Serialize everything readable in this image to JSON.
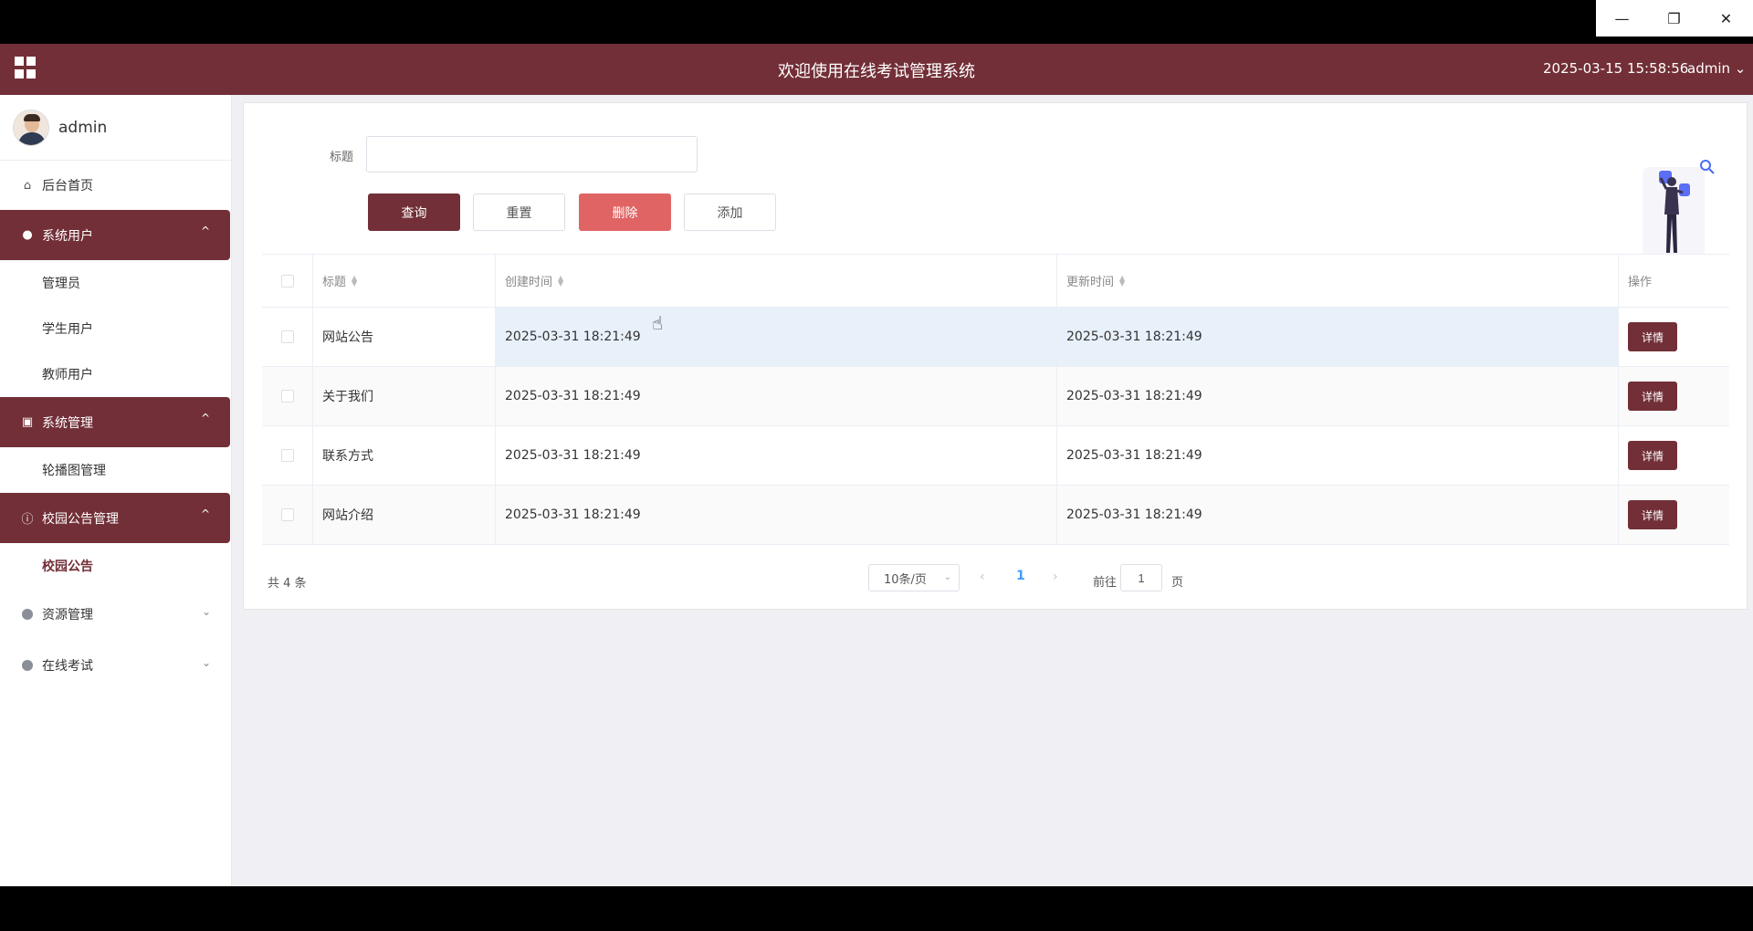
{
  "window": {
    "minimize_icon": "minimize-icon",
    "restore_icon": "restore-icon",
    "close_icon": "close-icon"
  },
  "header": {
    "title": "欢迎使用在线考试管理系统",
    "datetime": "2025-03-15 15:58:56",
    "user": "admin",
    "user_caret": "⌄"
  },
  "sidebar": {
    "profile_name": "admin",
    "home_label": "后台首页",
    "groups": [
      {
        "label": "系统用户",
        "items": [
          "管理员",
          "学生用户",
          "教师用户"
        ]
      },
      {
        "label": "系统管理",
        "items": [
          "轮播图管理"
        ]
      },
      {
        "label": "校园公告管理",
        "items": [
          "校园公告"
        ]
      }
    ],
    "collapsed": [
      "资源管理",
      "在线考试"
    ],
    "chevron_up": "^",
    "chevron_down": "⌄"
  },
  "search": {
    "label": "标题",
    "value": "",
    "placeholder": ""
  },
  "toolbar": {
    "query_label": "查询",
    "reset_label": "重置",
    "delete_label": "删除",
    "add_label": "添加"
  },
  "table": {
    "columns": [
      "标题",
      "创建时间",
      "更新时间",
      "操作"
    ],
    "rows": [
      {
        "title": "网站公告",
        "created": "2025-03-31 18:21:49",
        "updated": "2025-03-31 18:21:49",
        "action": "详情"
      },
      {
        "title": "关于我们",
        "created": "2025-03-31 18:21:49",
        "updated": "2025-03-31 18:21:49",
        "action": "详情"
      },
      {
        "title": "联系方式",
        "created": "2025-03-31 18:21:49",
        "updated": "2025-03-31 18:21:49",
        "action": "详情"
      },
      {
        "title": "网站介绍",
        "created": "2025-03-31 18:21:49",
        "updated": "2025-03-31 18:21:49",
        "action": "详情"
      }
    ]
  },
  "pagination": {
    "total": "共 4 条",
    "page_size": "10条/页",
    "current_page": "1",
    "goto_label": "前往",
    "goto_value": "1",
    "goto_unit": "页"
  },
  "colors": {
    "brand": "#722f37",
    "danger": "#e06464",
    "active_page": "#409eff"
  }
}
